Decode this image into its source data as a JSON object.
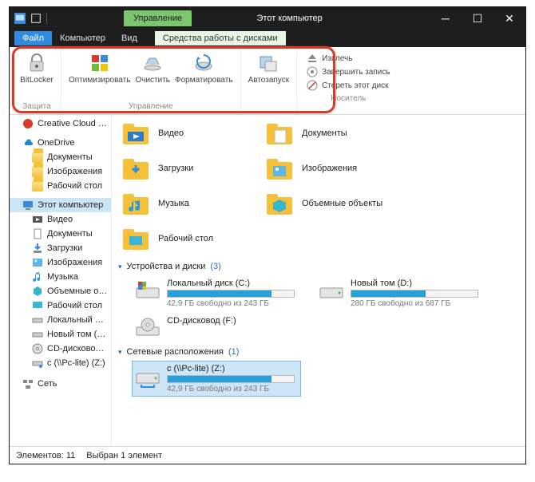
{
  "title": "Этот компьютер",
  "context_tab": "Управление",
  "menu": {
    "file": "Файл",
    "computer": "Компьютер",
    "view": "Вид",
    "ctx": "Средства работы с дисками"
  },
  "ribbon": {
    "protect": {
      "bitlocker": "BitLocker",
      "group": "Защита"
    },
    "manage": {
      "optimize": "Оптимизировать",
      "cleanup": "Очистить",
      "format": "Форматировать",
      "group": "Управление"
    },
    "autorun": {
      "btn": "Автозапуск"
    },
    "media": {
      "eject": "Извлечь",
      "finish": "Завершить запись",
      "erase": "Стереть этот диск",
      "group": "Носитель"
    }
  },
  "nav": {
    "ccf": "Creative Cloud Files",
    "onedrive": "OneDrive",
    "od_docs": "Документы",
    "od_pics": "Изображения",
    "od_desk": "Рабочий стол",
    "thispc": "Этот компьютер",
    "videos": "Видео",
    "docs": "Документы",
    "downloads": "Загрузки",
    "pics": "Изображения",
    "music": "Музыка",
    "obj3d": "Объемные объекты",
    "desktop": "Рабочий стол",
    "local_c": "Локальный диск (C:)",
    "new_d": "Новый том (D:)",
    "cd_f": "CD-дисковод (F:)",
    "net_z": "c (\\\\Pc-lite) (Z:)",
    "network": "Сеть"
  },
  "folders": {
    "videos": "Видео",
    "docs": "Документы",
    "downloads": "Загрузки",
    "pics": "Изображения",
    "music": "Музыка",
    "obj3d": "Объемные объекты",
    "desktop": "Рабочий стол"
  },
  "groups": {
    "drives": "Устройства и диски",
    "drives_count": "(3)",
    "net": "Сетевые расположения",
    "net_count": "(1)"
  },
  "drives": {
    "c": {
      "name": "Локальный диск (C:)",
      "free": "42,9 ГБ свободно из 243 ГБ",
      "pct": 82
    },
    "d": {
      "name": "Новый том (D:)",
      "free": "280 ГБ свободно из 687 ГБ",
      "pct": 59
    },
    "f": {
      "name": "CD-дисковод (F:)"
    },
    "z": {
      "name": "c (\\\\Pc-lite) (Z:)",
      "free": "42,9 ГБ свободно из 243 ГБ",
      "pct": 82
    }
  },
  "status": {
    "items": "Элементов: 11",
    "sel": "Выбран 1 элемент"
  }
}
